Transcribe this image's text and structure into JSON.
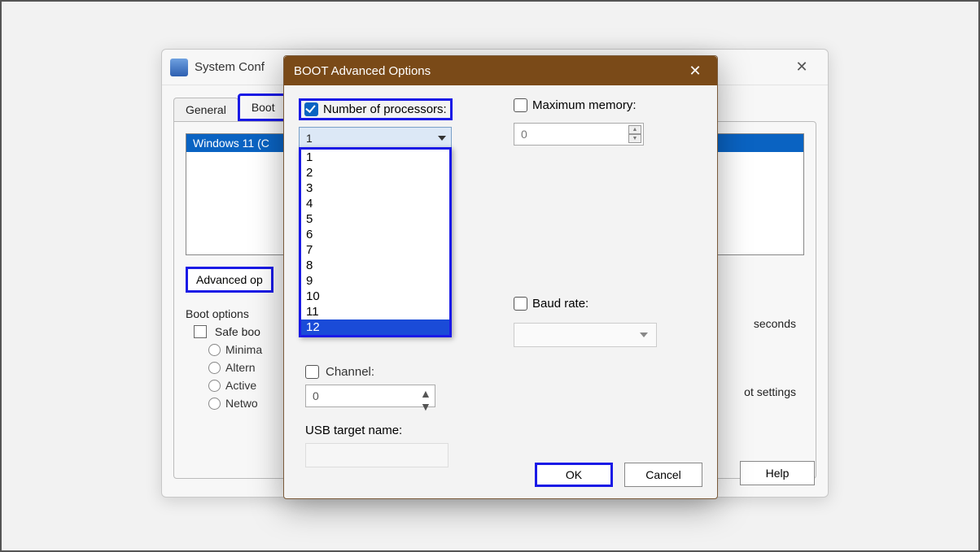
{
  "sysconf": {
    "title": "System Conf",
    "tabs": {
      "general": "General",
      "boot": "Boot"
    },
    "os_entry": "Windows 11 (C",
    "advanced_btn": "Advanced op",
    "boot_options_title": "Boot options",
    "safe_boot": "Safe boo",
    "opts": {
      "minimal": "Minima",
      "altern": "Altern",
      "active": "Active",
      "netwo": "Netwo"
    },
    "timeout_suffix": "seconds",
    "persist": "ot settings",
    "help": "Help"
  },
  "boot_dialog": {
    "title": "BOOT Advanced Options",
    "num_proc_label": "Number of processors:",
    "num_proc_value": "1",
    "proc_options": [
      "1",
      "2",
      "3",
      "4",
      "5",
      "6",
      "7",
      "8",
      "9",
      "10",
      "11",
      "12"
    ],
    "proc_selected": "12",
    "max_mem_label": "Maximum memory:",
    "max_mem_value": "0",
    "baud_label": "Baud rate:",
    "channel_label": "Channel:",
    "channel_value": "0",
    "usb_label": "USB target name:",
    "ok": "OK",
    "cancel": "Cancel"
  }
}
